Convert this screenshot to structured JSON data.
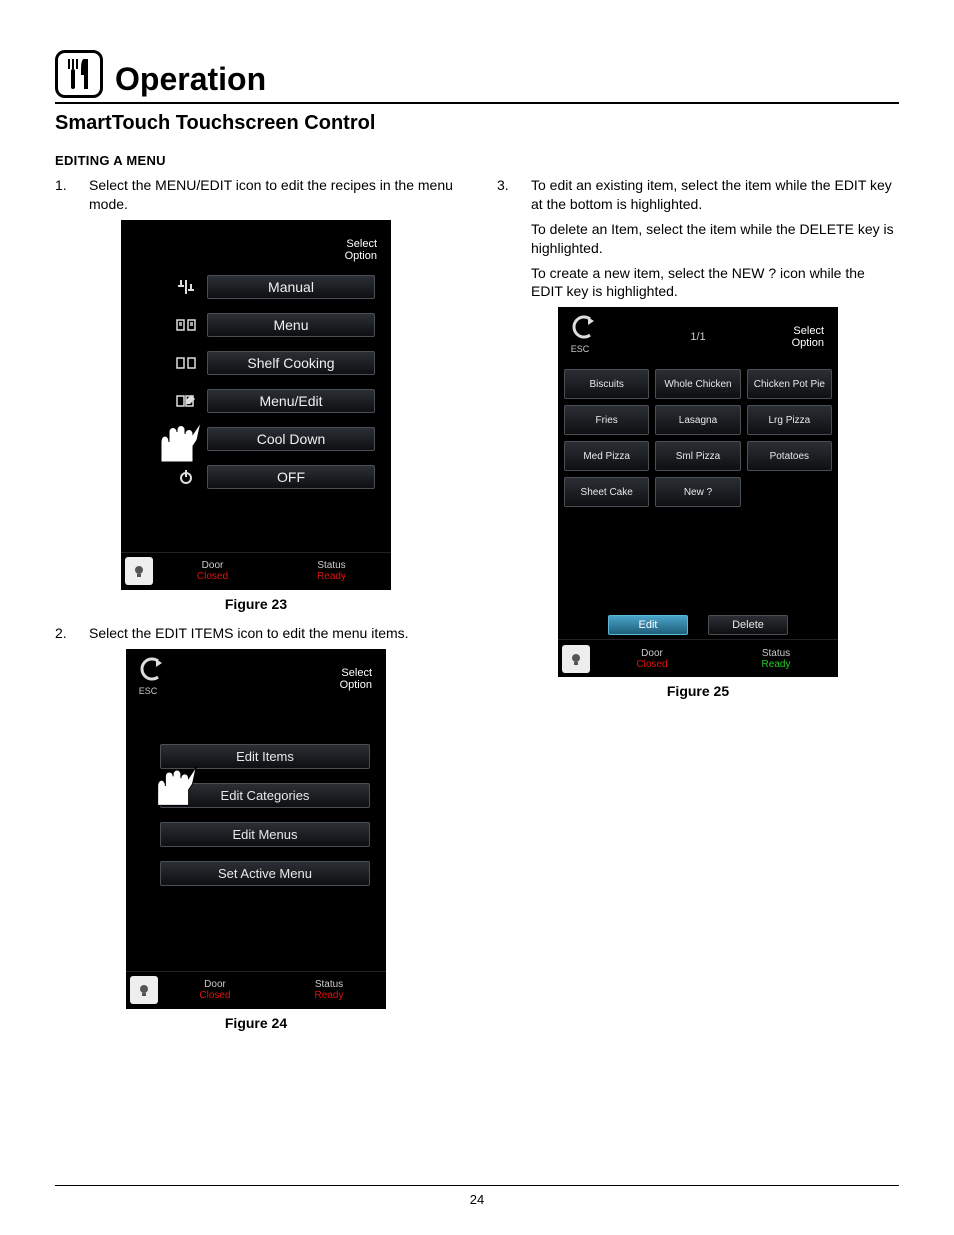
{
  "page_number": "24",
  "header": {
    "title": "Operation"
  },
  "subtitle": "SmartTouch Touchscreen Control",
  "section_head": "EDITING A MENU",
  "left": {
    "step1_num": "1.",
    "step1": "Select the MENU/EDIT icon to edit the recipes in the menu mode.",
    "step2_num": "2.",
    "step2": "Select the EDIT ITEMS icon to edit the menu items.",
    "fig23": "Figure 23",
    "fig24": "Figure 24"
  },
  "right": {
    "step3_num": "3.",
    "step3a": "To edit an existing item, select the item while the EDIT key at the bottom is highlighted.",
    "step3b": "To delete an Item, select the item while the DELETE key is highlighted.",
    "step3c": "To create a new item, select the NEW ? icon while the EDIT key is highlighted.",
    "fig25": "Figure 25"
  },
  "ui": {
    "select_label1": "Select",
    "select_label2": "Option",
    "esc": "ESC",
    "door_label": "Door",
    "door_val": "Closed",
    "status_label": "Status",
    "status_val": "Ready",
    "panelA": {
      "items": [
        "Manual",
        "Menu",
        "Shelf  Cooking",
        "Menu/Edit",
        "Cool  Down",
        "OFF"
      ]
    },
    "panelB": {
      "items": [
        "Edit  Items",
        "Edit  Categories",
        "Edit  Menus",
        "Set  Active  Menu"
      ]
    },
    "panelC": {
      "page_ind": "1/1",
      "cells": [
        "Biscuits",
        "Whole Chicken",
        "Chicken Pot  Pie",
        "Fries",
        "Lasagna",
        "Lrg  Pizza",
        "Med  Pizza",
        "Sml  Pizza",
        "Potatoes",
        "Sheet Cake",
        "New  ?"
      ],
      "edit": "Edit",
      "delete": "Delete"
    }
  },
  "chart_data": null
}
